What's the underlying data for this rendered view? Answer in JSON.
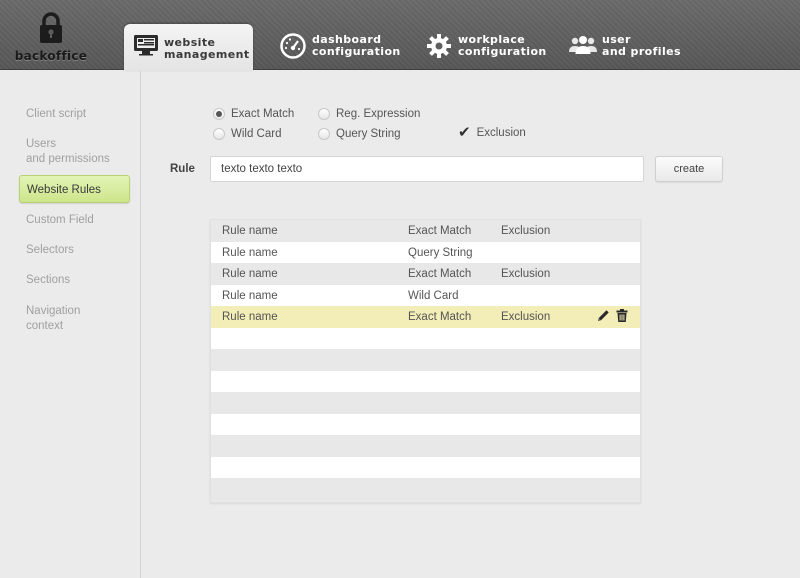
{
  "app": {
    "logo_text": "backoffice"
  },
  "tabs": [
    {
      "label_line1": "website",
      "label_line2": "management",
      "icon": "monitor-icon",
      "active": true
    },
    {
      "label_line1": "dashboard",
      "label_line2": "configuration",
      "icon": "speedometer-icon"
    },
    {
      "label_line1": "workplace",
      "label_line2": "configuration",
      "icon": "gear-icon"
    },
    {
      "label_line1": "user",
      "label_line2": "and profiles",
      "icon": "users-icon"
    }
  ],
  "sidebar": {
    "items": [
      {
        "label": "Client script"
      },
      {
        "label": "Users\nand permissions"
      },
      {
        "label": "Website Rules",
        "active": true
      },
      {
        "label": "Custom Field"
      },
      {
        "label": "Selectors"
      },
      {
        "label": "Sections"
      },
      {
        "label": "Navigation\ncontext"
      }
    ]
  },
  "options": {
    "exact_match": "Exact Match",
    "reg_expression": "Reg. Expression",
    "wild_card": "Wild Card",
    "query_string": "Query String",
    "exclusion": "Exclusion",
    "selected_match": "Exact Match",
    "exclusion_checked": true
  },
  "rule": {
    "label": "Rule",
    "value": "texto texto texto",
    "create_label": "create"
  },
  "table": {
    "rows": [
      {
        "name": "Rule name",
        "match": "Exact Match",
        "exclusion": "Exclusion"
      },
      {
        "name": "Rule name",
        "match": "Query String",
        "exclusion": ""
      },
      {
        "name": "Rule name",
        "match": "Exact Match",
        "exclusion": "Exclusion"
      },
      {
        "name": "Rule name",
        "match": "Wild Card",
        "exclusion": ""
      },
      {
        "name": "Rule name",
        "match": "Exact Match",
        "exclusion": "Exclusion",
        "highlighted": true
      }
    ],
    "empty_rows": 8
  },
  "colors": {
    "active_sidebar": "#cde58b",
    "highlight_row": "#f3edb7",
    "topbar": "#5f5f5f"
  }
}
